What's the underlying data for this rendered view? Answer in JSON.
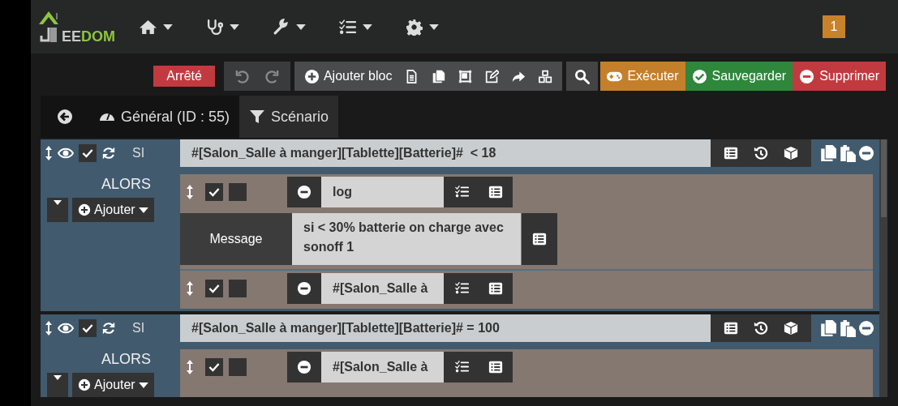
{
  "navbar": {
    "logo": [
      {
        "text": "EE",
        "color": "#c8c8c8"
      },
      {
        "text": "DOM",
        "color": "#8cc63f"
      }
    ],
    "badge": "1"
  },
  "toolbar": {
    "status": {
      "label": "Arrêté",
      "kind": "stopped"
    },
    "history": [
      {
        "disabled": true
      },
      {
        "disabled": true
      }
    ],
    "add_block": "Ajouter bloc",
    "actions": [
      {
        "label": "Exécuter",
        "kind": "run"
      },
      {
        "label": "Sauvegarder",
        "kind": "save"
      },
      {
        "label": "Supprimer",
        "kind": "delete"
      }
    ]
  },
  "tabs": [
    {
      "label": "Général (ID : 55)",
      "selected": false
    },
    {
      "label": "Scénario",
      "selected": true
    }
  ],
  "blocks": [
    {
      "keyword": "SI",
      "enabled": true,
      "condition": "#[Salon_Salle à manger][Tablette][Batterie]#  < 18",
      "then_label": "ALORS",
      "add_label": "Ajouter",
      "actions": [
        {
          "enabled": true,
          "parallel": false,
          "command": "log",
          "options": [
            {
              "label": "Message",
              "value": "si < 30% batterie on charge avec sonoff 1"
            }
          ]
        },
        {
          "enabled": true,
          "parallel": false,
          "command": "#[Salon_Salle à"
        }
      ]
    },
    {
      "keyword": "SI",
      "enabled": true,
      "condition": "#[Salon_Salle à manger][Tablette][Batterie]# = 100",
      "then_label": "ALORS",
      "add_label": "Ajouter",
      "actions": [
        {
          "enabled": true,
          "parallel": false,
          "command": "#[Salon_Salle à"
        }
      ]
    }
  ]
}
